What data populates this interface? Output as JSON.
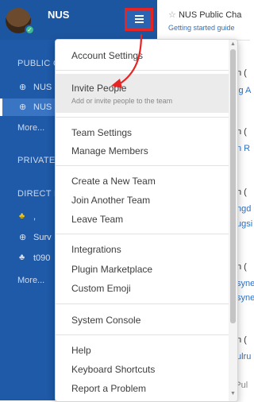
{
  "team": {
    "name": "NUS"
  },
  "sidebar": {
    "sections": [
      {
        "title": "PUBLIC C"
      },
      {
        "title": "PRIVATE"
      },
      {
        "title": "DIRECT I"
      }
    ],
    "public_items": [
      {
        "icon": "globe-icon",
        "label": "NUS"
      },
      {
        "icon": "globe-icon",
        "label": "NUS"
      }
    ],
    "public_more": "More...",
    "direct_items": [
      {
        "icon": "user-group-icon",
        "label": ","
      },
      {
        "icon": "globe-icon",
        "label": "Surv"
      },
      {
        "icon": "user-group-icon",
        "label": "t090"
      }
    ],
    "direct_more": "More..."
  },
  "channel": {
    "title": "NUS Public Cha",
    "subtitle": "Getting started guide",
    "fragments": [
      {
        "text": "n (",
        "link": false
      },
      {
        "text": "ig A",
        "link": true
      },
      {
        "text": "n (",
        "link": false
      },
      {
        "text": "n R",
        "link": true
      },
      {
        "text": "n (",
        "link": false
      },
      {
        "text": "ngd",
        "link": true
      },
      {
        "text": "ugsi",
        "link": true
      },
      {
        "text": "n (",
        "link": false
      },
      {
        "text": "syne",
        "link": true
      },
      {
        "text": "syne",
        "link": true
      },
      {
        "text": "n (",
        "link": false
      },
      {
        "text": "ulru",
        "link": true
      }
    ],
    "input_placeholder": "Pul"
  },
  "menu": {
    "items": [
      {
        "label": "Account Settings"
      },
      {
        "label": "Invite People",
        "description": "Add or invite people to the team"
      },
      {
        "label": "Team Settings"
      },
      {
        "label": "Manage Members"
      },
      {
        "label": "Create a New Team"
      },
      {
        "label": "Join Another Team"
      },
      {
        "label": "Leave Team"
      },
      {
        "label": "Integrations"
      },
      {
        "label": "Plugin Marketplace"
      },
      {
        "label": "Custom Emoji"
      },
      {
        "label": "System Console"
      },
      {
        "label": "Help"
      },
      {
        "label": "Keyboard Shortcuts"
      },
      {
        "label": "Report a Problem"
      }
    ]
  },
  "colors": {
    "sidebar": "#1e5aa8",
    "annotation": "#e62423",
    "link": "#2a72c8"
  }
}
